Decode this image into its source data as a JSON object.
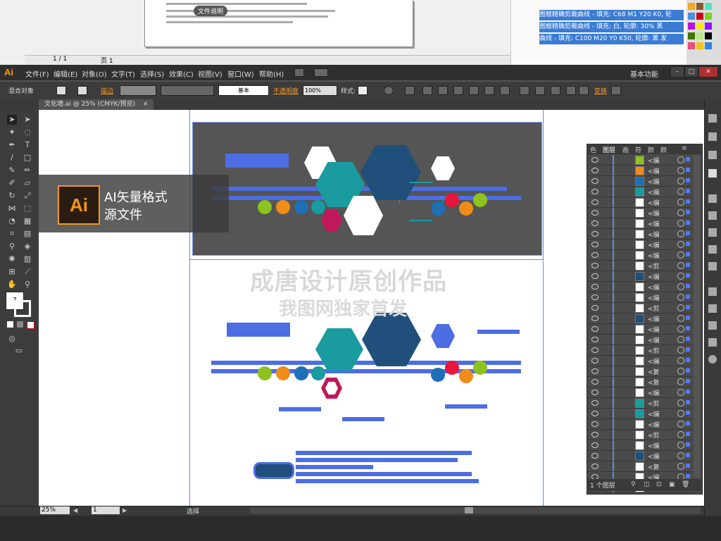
{
  "top_document": {
    "file_note_label": "文件说明",
    "nav": {
      "page_info": "1 / 1",
      "page_label": "页 1"
    },
    "layer_rows": [
      "图框精确剪裁曲线 - 填充: C68 M1 Y20 K0, 轮",
      "图框精确剪裁曲线 - 填充: 白, 轮廓: 30% 黑",
      "曲线 - 填充: C100 M20 Y0 K50, 轮廓: 黑 发"
    ]
  },
  "menubar": {
    "app_logo": "Ai",
    "items": [
      "文件(F)",
      "编辑(E)",
      "对象(O)",
      "文字(T)",
      "选择(S)",
      "效果(C)",
      "视图(V)",
      "窗口(W)",
      "帮助(H)"
    ],
    "workspace": "基本功能"
  },
  "control_bar": {
    "selection_label": "混合对象",
    "stroke_label": "描边",
    "stroke_style": "基本",
    "opacity_label": "不透明度",
    "opacity_value": "100%",
    "style_label": "样式:",
    "transform_label": "变换"
  },
  "document_tab": "文化墙.ai @ 25% (CMYK/预览)",
  "overlay": {
    "ai_icon": "Ai",
    "line1": "AI矢量格式",
    "line2": "源文件",
    "watermark_main": "成唐设计原创作品",
    "watermark_sub": "我图网独家首发"
  },
  "status_bar": {
    "zoom": "25%",
    "page": "1",
    "tool_status": "选择"
  },
  "layers_panel": {
    "tabs": [
      "色",
      "图层",
      "画",
      "符",
      "颜",
      "颜"
    ],
    "rows": [
      {
        "label": "<编",
        "color": "#8dc21f"
      },
      {
        "label": "<编",
        "color": "#f08c1a"
      },
      {
        "label": "<编",
        "color": "#1e6fb5"
      },
      {
        "label": "<编",
        "color": "#1a9ba0"
      },
      {
        "label": "<编",
        "color": "#ffffff"
      },
      {
        "label": "<编",
        "color": "#ffffff"
      },
      {
        "label": "<编",
        "color": "#ffffff"
      },
      {
        "label": "<编",
        "color": "#ffffff"
      },
      {
        "label": "<编",
        "color": "#ffffff"
      },
      {
        "label": "<编",
        "color": "#ffffff"
      },
      {
        "label": "<剪",
        "color": "#ffffff"
      },
      {
        "label": "<编",
        "color": "#1f4f7a"
      },
      {
        "label": "<编",
        "color": "#ffffff"
      },
      {
        "label": "<编",
        "color": "#ffffff"
      },
      {
        "label": "<剪",
        "color": "#ffffff"
      },
      {
        "label": "<编",
        "color": "#1f4f7a"
      },
      {
        "label": "<编",
        "color": "#ffffff"
      },
      {
        "label": "<编",
        "color": "#ffffff"
      },
      {
        "label": "<剪",
        "color": "#ffffff"
      },
      {
        "label": "<编",
        "color": "#ffffff"
      },
      {
        "label": "<复",
        "color": "#ffffff"
      },
      {
        "label": "<复",
        "color": "#ffffff"
      },
      {
        "label": "<编",
        "color": "#ffffff"
      },
      {
        "label": "<剪",
        "color": "#1a9ba0"
      },
      {
        "label": "<编",
        "color": "#1a9ba0"
      },
      {
        "label": "<编",
        "color": "#ffffff"
      },
      {
        "label": "<剪",
        "color": "#ffffff"
      },
      {
        "label": "<编",
        "color": "#ffffff"
      },
      {
        "label": "<编",
        "color": "#1f4f7a"
      },
      {
        "label": "<复",
        "color": "#ffffff"
      },
      {
        "label": "<编",
        "color": "#ffffff"
      },
      {
        "label": "<编",
        "color": "#ffffff"
      }
    ],
    "layer_count": "1 个图层"
  }
}
